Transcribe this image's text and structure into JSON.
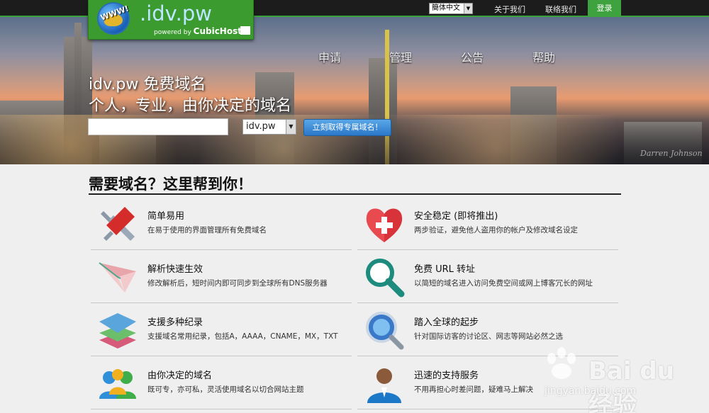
{
  "topbar": {
    "language": "簡体中文",
    "links": [
      "关于我们",
      "联络我们"
    ],
    "login": "登录"
  },
  "logo": {
    "badge_text": "WWW!",
    "domain": ".idv.pw",
    "powered_prefix": "powered by ",
    "powered_brand": "CubicHost"
  },
  "nav": [
    "申请",
    "管理",
    "公告",
    "帮助"
  ],
  "hero": {
    "title": "idv.pw 免费域名",
    "subtitle": "个人，专业，由你决定的域名",
    "input_value": "",
    "tld": "idv.pw",
    "button": "立刻取得专属域名！",
    "photo_credit": "Darren Johnson"
  },
  "section": {
    "title": "需要域名？这里帮到你！"
  },
  "features": [
    {
      "icon": "tools-icon",
      "title": "简单易用",
      "desc": "在易于使用的界面管理所有免费域名"
    },
    {
      "icon": "heart-shield-icon",
      "title": "安全稳定 (即将推出)",
      "desc": "两步验证，避免他人盗用你的帐户及修改域名设定"
    },
    {
      "icon": "paper-plane-icon",
      "title": "解析快速生效",
      "desc": "修改解析后，短时间内即可同步到全球所有DNS服务器"
    },
    {
      "icon": "magnifier-icon",
      "title": "免费 URL 转址",
      "desc": "以简短的域名进入访问免费空间或网上博客冗长的网址"
    },
    {
      "icon": "layers-icon",
      "title": "支援多种纪录",
      "desc": "支援域名常用纪录，包括A，AAAA，CNAME，MX，TXT"
    },
    {
      "icon": "globe-search-icon",
      "title": "踏入全球的起步",
      "desc": "针对国际访客的讨论区、网志等网站必然之选"
    },
    {
      "icon": "users-icon",
      "title": "由你决定的域名",
      "desc": "既可专，亦可私，灵活使用域名以切合网站主题"
    },
    {
      "icon": "support-person-icon",
      "title": "迅速的支持服务",
      "desc": "不用再担心时差问题，疑难马上解决"
    }
  ],
  "watermark": {
    "brand": "Bai du 经验",
    "url": "jingyan.baidu.com"
  }
}
